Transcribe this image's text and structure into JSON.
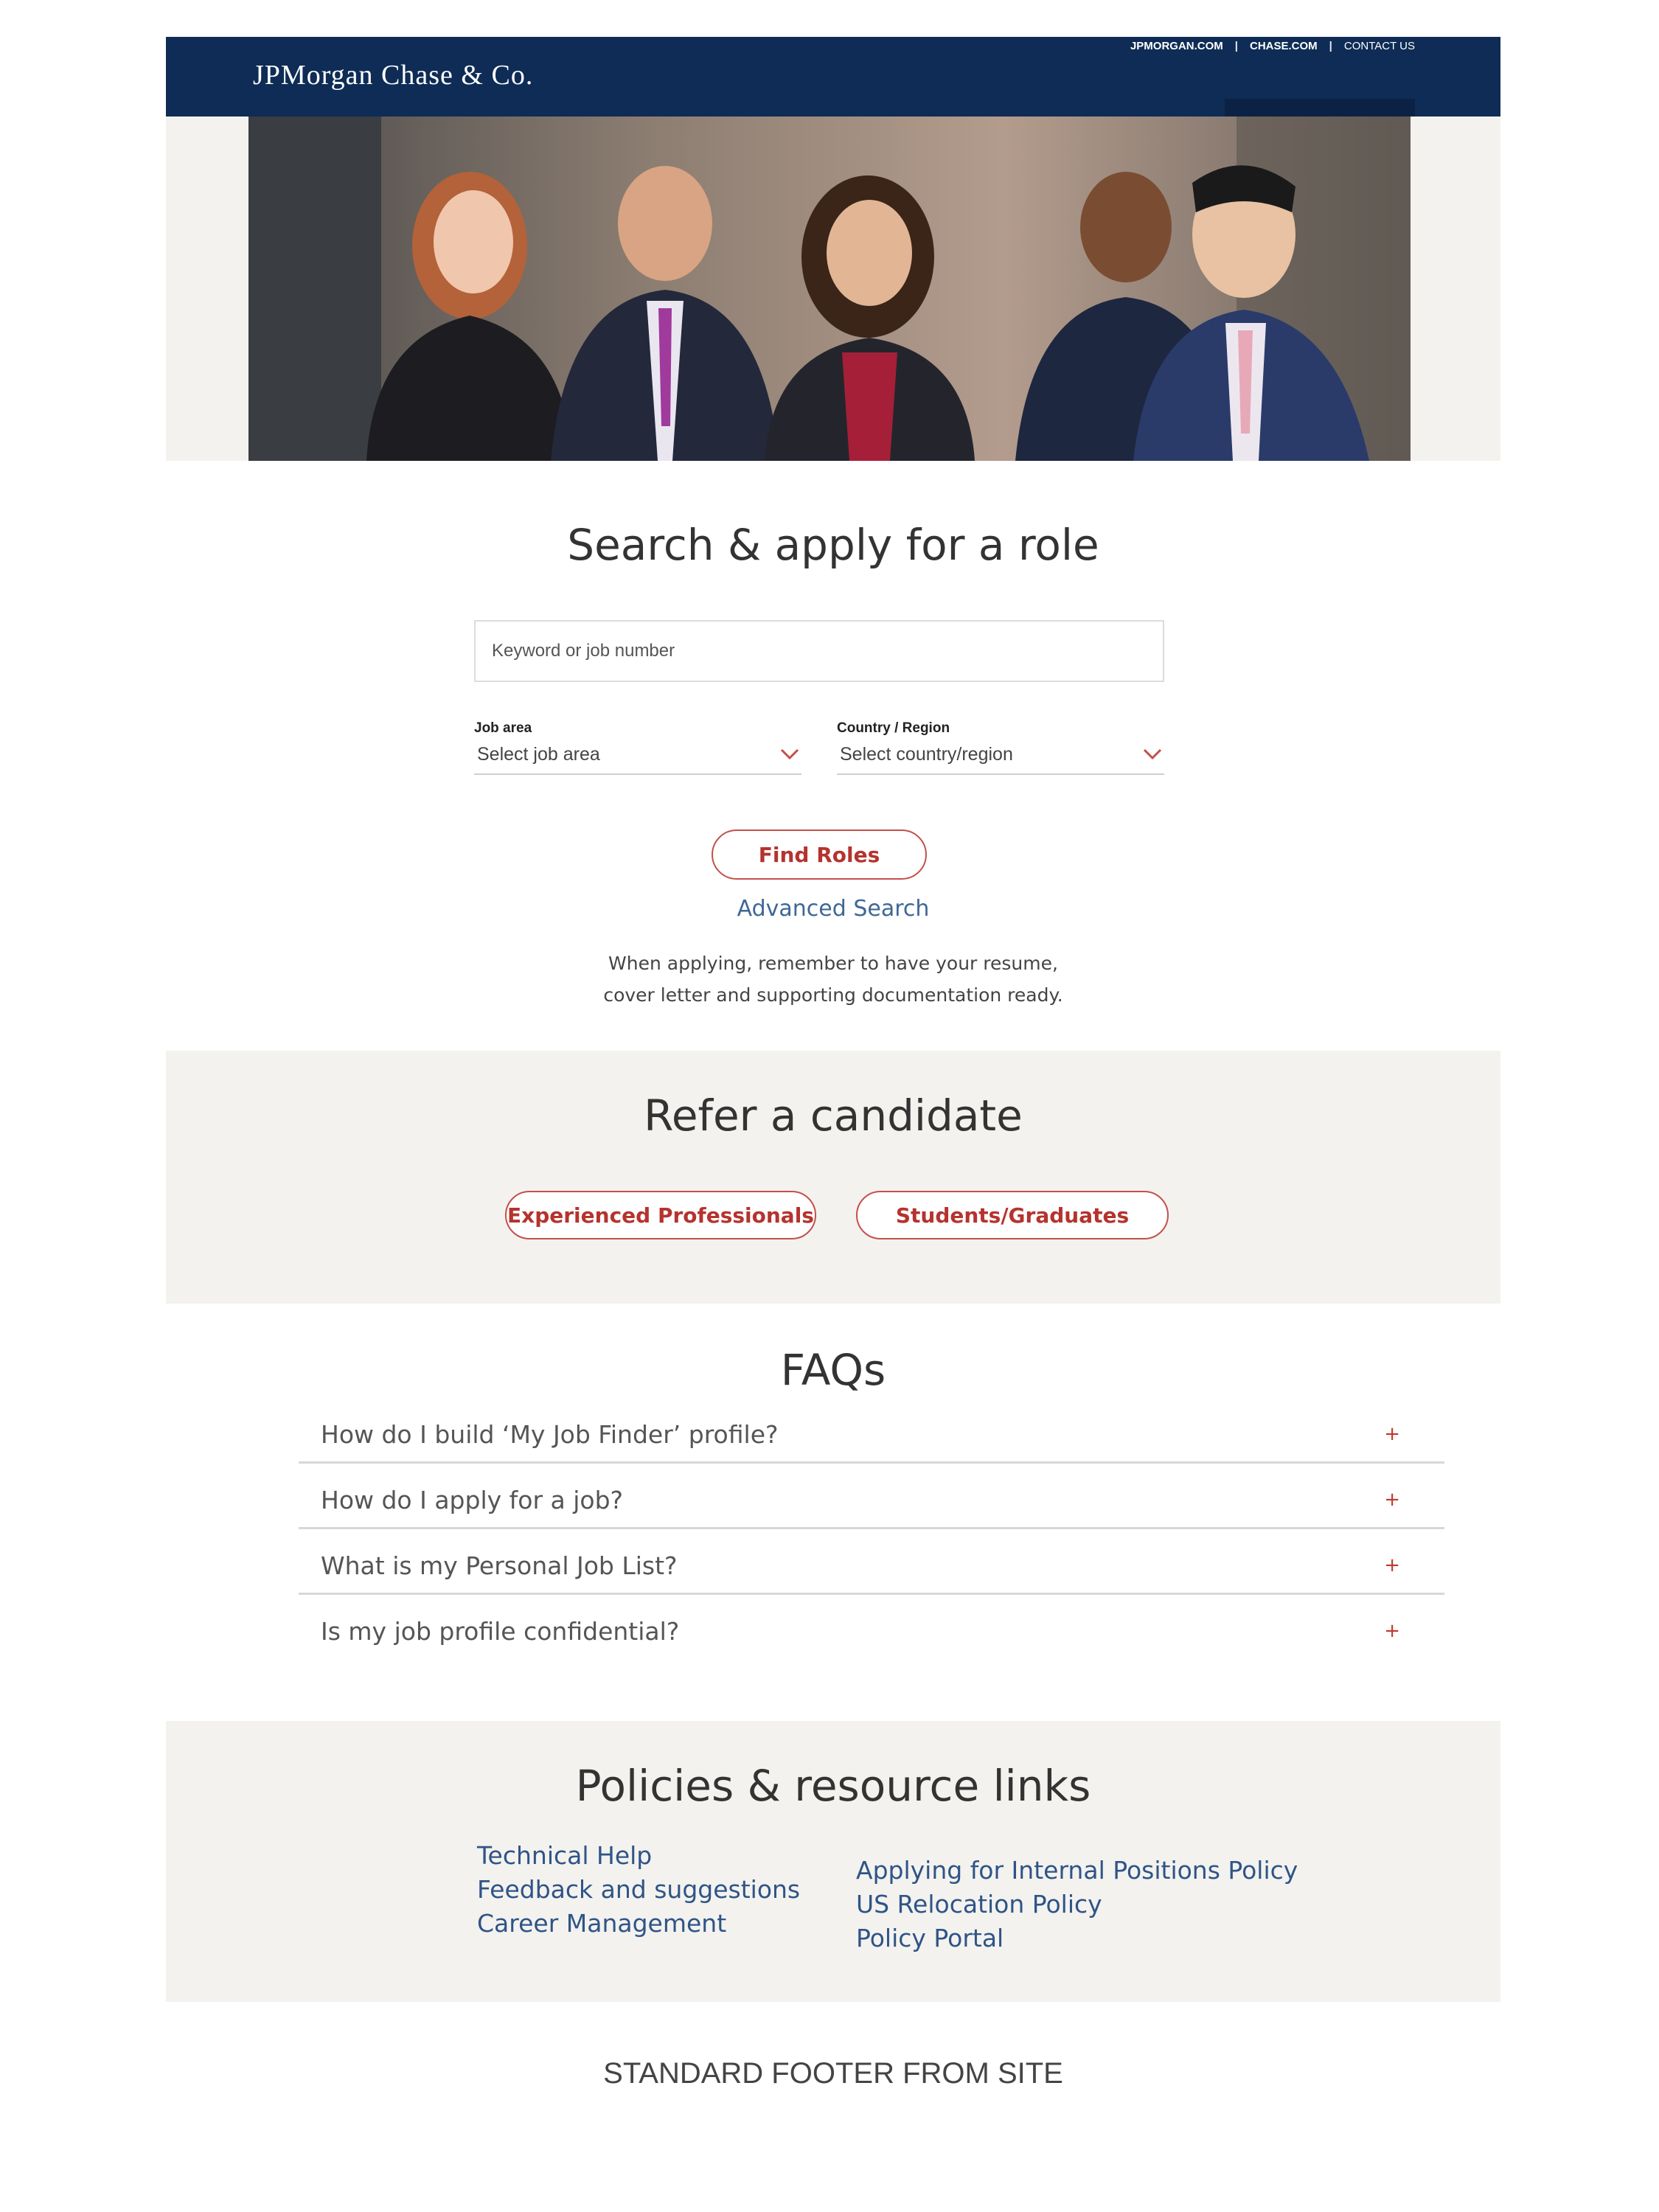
{
  "header": {
    "logo": "JPMorgan Chase & Co.",
    "links": [
      "JPMORGAN.COM",
      "CHASE.COM",
      "CONTACT US"
    ],
    "separator": "|",
    "brand_color": "#0e2c55"
  },
  "search": {
    "title": "Search & apply for a role",
    "keyword_placeholder": "Keyword or job number",
    "job_area": {
      "label": "Job area",
      "value": "Select job area"
    },
    "country": {
      "label": "Country / Region",
      "value": "Select country/region"
    },
    "find_button": "Find Roles",
    "advanced_link": "Advanced Search",
    "note_line1": "When applying, remember to have your resume,",
    "note_line2": "cover letter and supporting documentation ready."
  },
  "refer": {
    "title": "Refer a candidate",
    "experienced_button": "Experienced Professionals",
    "students_button": "Students/Graduates"
  },
  "faqs": {
    "title": "FAQs",
    "items": [
      {
        "question": "How do I build ‘My Job Finder’ profile?",
        "icon": "+"
      },
      {
        "question": "How do I apply for a job?",
        "icon": "+"
      },
      {
        "question": "What is my Personal Job List?",
        "icon": "+"
      },
      {
        "question": "Is my job profile confidential?",
        "icon": "+"
      }
    ]
  },
  "policies": {
    "title": "Policies & resource links",
    "left_links": [
      "Technical Help",
      "Feedback and suggestions",
      "Career Management"
    ],
    "right_links": [
      "Applying for Internal Positions Policy",
      "US Relocation Policy",
      "Policy Portal"
    ]
  },
  "footer": {
    "text": "STANDARD FOOTER FROM SITE"
  },
  "colors": {
    "accent_red": "#c4504b",
    "link_blue": "#2f5487",
    "section_bg": "#f3f2ee"
  }
}
